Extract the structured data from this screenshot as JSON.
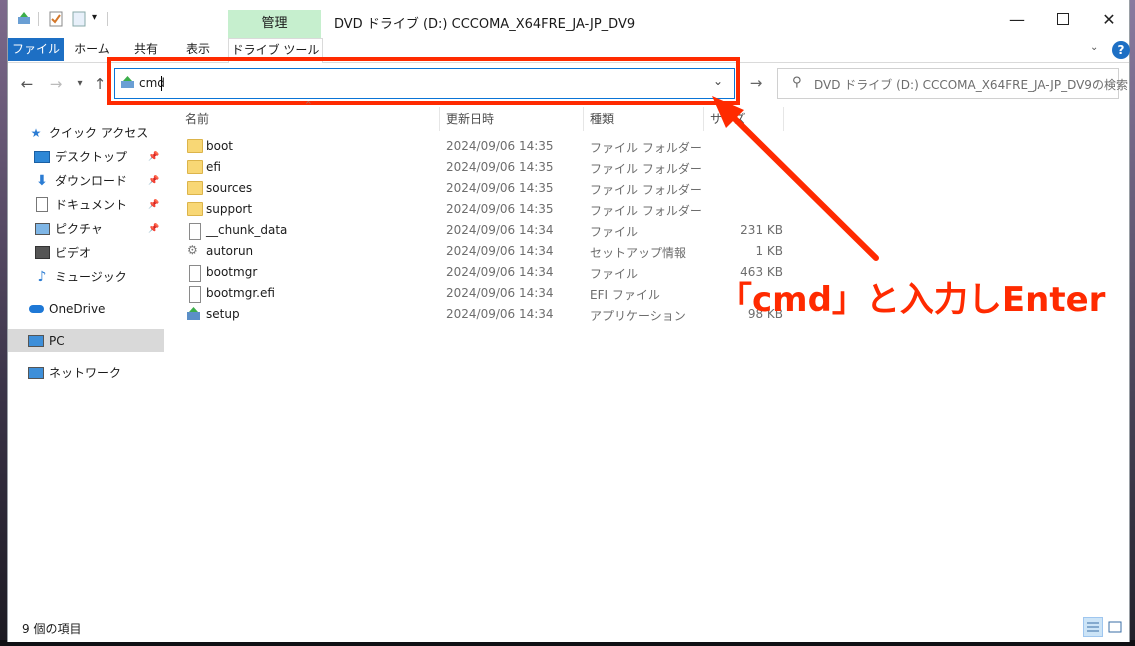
{
  "window": {
    "title": "DVD ドライブ (D:) CCCOMA_X64FRE_JA-JP_DV9",
    "context_tab_header": "管理",
    "minimize_icon": "minimize-icon",
    "maximize_icon": "maximize-icon",
    "close_icon": "close-icon"
  },
  "ribbon": {
    "tabs": [
      "ファイル",
      "ホーム",
      "共有",
      "表示",
      "ドライブ ツール"
    ],
    "accent": "#1d6fc4"
  },
  "address": {
    "value": "cmd",
    "search_placeholder": "DVD ドライブ (D:) CCCOMA_X64FRE_JA-JP_DV9の検索"
  },
  "columns": [
    "名前",
    "更新日時",
    "種類",
    "サイズ"
  ],
  "nav": {
    "items": [
      {
        "label": "クイック アクセス",
        "icon": "star-icon"
      },
      {
        "label": "デスクトップ",
        "icon": "desktop-icon"
      },
      {
        "label": "ダウンロード",
        "icon": "download-icon"
      },
      {
        "label": "ドキュメント",
        "icon": "document-icon"
      },
      {
        "label": "ピクチャ",
        "icon": "picture-icon"
      },
      {
        "label": "ビデオ",
        "icon": "video-icon"
      },
      {
        "label": "ミュージック",
        "icon": "music-icon"
      },
      {
        "label": "OneDrive",
        "icon": "cloud-icon"
      },
      {
        "label": "PC",
        "icon": "pc-icon"
      },
      {
        "label": "ネットワーク",
        "icon": "network-icon"
      }
    ]
  },
  "files": [
    {
      "name": "boot",
      "date": "2024/09/06 14:35",
      "type": "ファイル フォルダー",
      "size": "",
      "icon": "folder-icon"
    },
    {
      "name": "efi",
      "date": "2024/09/06 14:35",
      "type": "ファイル フォルダー",
      "size": "",
      "icon": "folder-icon"
    },
    {
      "name": "sources",
      "date": "2024/09/06 14:35",
      "type": "ファイル フォルダー",
      "size": "",
      "icon": "folder-icon"
    },
    {
      "name": "support",
      "date": "2024/09/06 14:35",
      "type": "ファイル フォルダー",
      "size": "",
      "icon": "folder-icon"
    },
    {
      "name": "__chunk_data",
      "date": "2024/09/06 14:34",
      "type": "ファイル",
      "size": "231 KB",
      "icon": "file-icon"
    },
    {
      "name": "autorun",
      "date": "2024/09/06 14:34",
      "type": "セットアップ情報",
      "size": "1 KB",
      "icon": "settings-file-icon"
    },
    {
      "name": "bootmgr",
      "date": "2024/09/06 14:34",
      "type": "ファイル",
      "size": "463 KB",
      "icon": "file-icon"
    },
    {
      "name": "bootmgr.efi",
      "date": "2024/09/06 14:34",
      "type": "EFI ファイル",
      "size": "",
      "icon": "file-icon"
    },
    {
      "name": "setup",
      "date": "2024/09/06 14:34",
      "type": "アプリケーション",
      "size": "98 KB",
      "icon": "setup-app-icon"
    }
  ],
  "status": {
    "text": "9 個の項目"
  },
  "annotation": {
    "text": "「cmd」と入力しEnter",
    "color": "#ff2a00"
  }
}
